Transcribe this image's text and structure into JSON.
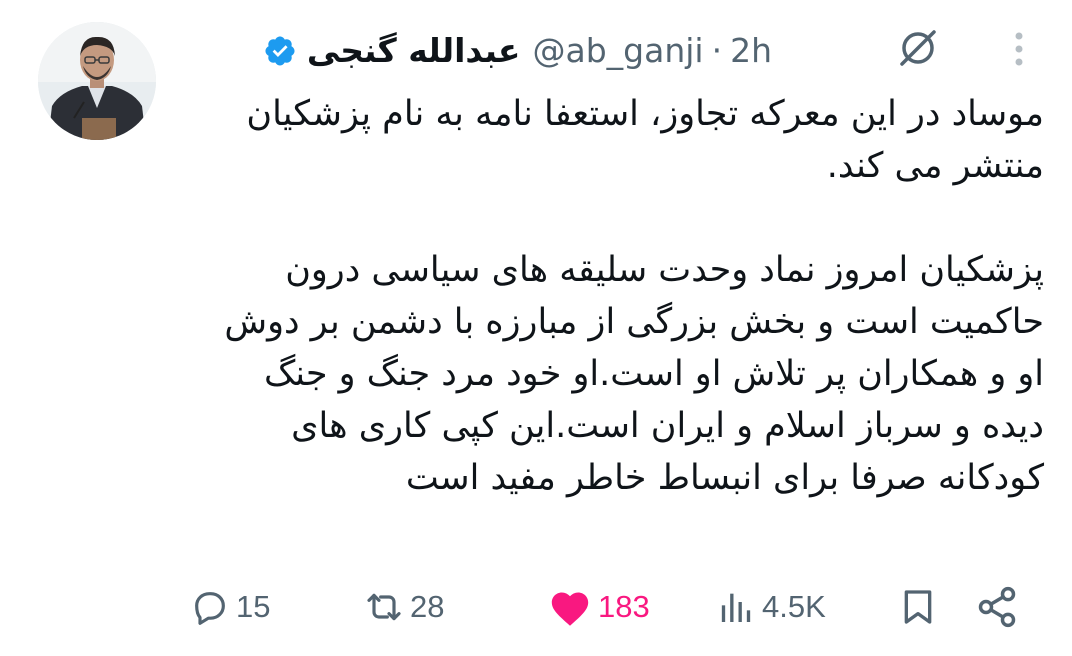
{
  "tweet": {
    "display_name": "عبدالله گنجی",
    "handle": "@ab_ganji",
    "separator": "·",
    "time": "2h",
    "paragraphs": [
      "موساد در این معرکه تجاوز، استعفا نامه به نام پزشکیان  منتشر می کند.",
      "پزشکیان امروز نماد وحدت سلیقه های سیاسی درون حاکمیت است و بخش بزرگی از مبارزه با دشمن بر دوش او و همکاران پر تلاش او است.او خود مرد جنگ و جنگ دیده و سرباز اسلام و ایران است.این کپی کاری های کودکانه صرفا برای انبساط خاطر مفید است"
    ]
  },
  "actions": {
    "replies": "15",
    "retweets": "28",
    "likes": "183",
    "views": "4.5K"
  },
  "icons": {
    "verified": "verified-badge-icon",
    "grok": "grok-icon",
    "more": "more-vertical-icon",
    "reply": "reply-icon",
    "retweet": "retweet-icon",
    "like": "heart-filled-icon",
    "views": "views-chart-icon",
    "bookmark": "bookmark-icon",
    "share": "share-icon"
  },
  "colors": {
    "text": "#0f1419",
    "secondary": "#536471",
    "verified": "#1d9bf0",
    "like": "#f91880"
  }
}
